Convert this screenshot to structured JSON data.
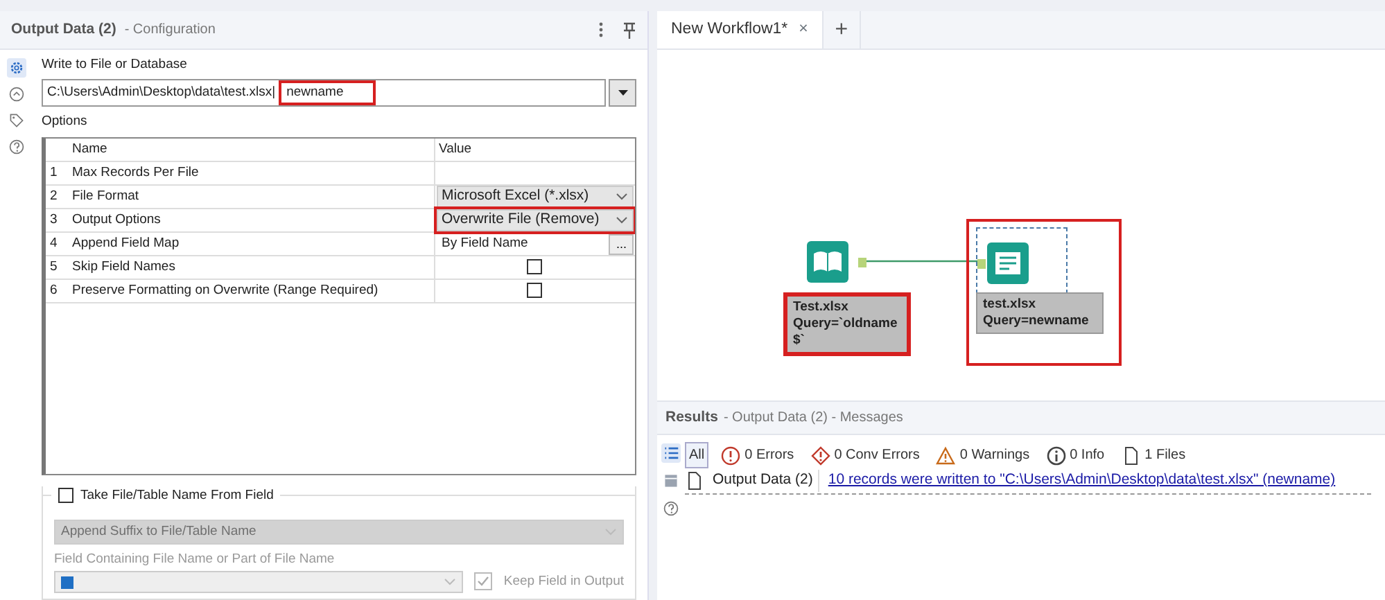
{
  "config_panel": {
    "title": "Output Data (2)",
    "subtitle": "- Configuration",
    "side_tabs": [
      {
        "kind": "gear",
        "selected": true
      },
      {
        "kind": "arrow",
        "selected": false
      },
      {
        "kind": "tag",
        "selected": false
      },
      {
        "kind": "help",
        "selected": false
      }
    ]
  },
  "write_to": {
    "label": "Write to File or Database",
    "path": "C:\\Users\\Admin\\Desktop\\data\\test.xlsx|",
    "suffix": "newname",
    "suffix_highlighted": true
  },
  "options": {
    "label": "Options",
    "columns": [
      "Name",
      "Value"
    ],
    "rows": [
      {
        "number": "1",
        "name": "Max Records Per File",
        "kind": "text",
        "highlighted": false
      },
      {
        "number": "2",
        "name": "File Format",
        "kind": "dropdown",
        "value": "Microsoft Excel (*.xlsx)",
        "highlighted": false
      },
      {
        "number": "3",
        "name": "Output Options",
        "kind": "dropdown",
        "value": "Overwrite File (Remove)",
        "highlighted": true
      },
      {
        "number": "4",
        "name": "Append Field Map",
        "kind": "ellipsis",
        "value": "By Field Name",
        "button_label": "...",
        "highlighted": false
      },
      {
        "number": "5",
        "name": "Skip Field Names",
        "kind": "checkbox",
        "checked": false,
        "highlighted": false
      },
      {
        "number": "6",
        "name": "Preserve Formatting on Overwrite (Range Required)",
        "kind": "checkbox",
        "checked": false,
        "highlighted": false
      }
    ]
  },
  "take_from_field": {
    "label": "Take File/Table Name From Field",
    "checked": false,
    "disabled": true,
    "mode": "Append Suffix to File/Table Name",
    "field_label": "Field Containing File Name or Part of File Name",
    "keep_field": {
      "label": "Keep Field in Output",
      "checked": true
    }
  },
  "workflow_tabs": [
    {
      "label": "New Workflow1*",
      "selected": true,
      "close": "×"
    }
  ],
  "new_tab": "+",
  "canvas": {
    "nodes": [
      {
        "kind": "input",
        "label_lines": [
          "Test.xlsx",
          "Query=`oldname",
          "$`"
        ],
        "highlighted": true,
        "selected": false
      },
      {
        "kind": "output",
        "label_lines": [
          "test.xlsx",
          "Query=newname"
        ],
        "highlighted": true,
        "selected": true
      }
    ]
  },
  "results": {
    "title": "Results",
    "subtitle": "- Output Data (2) - Messages",
    "side_tabs": [
      {
        "kind": "list",
        "selected": true
      },
      {
        "kind": "table",
        "selected": false
      },
      {
        "kind": "help",
        "selected": false
      }
    ],
    "filters": [
      {
        "kind": "all",
        "label": "All",
        "selected": true
      },
      {
        "kind": "error",
        "label": "0 Errors",
        "selected": false
      },
      {
        "kind": "conv",
        "label": "0 Conv Errors",
        "selected": false
      },
      {
        "kind": "warning",
        "label": "0 Warnings",
        "selected": false
      },
      {
        "kind": "info",
        "label": "0 Info",
        "selected": false
      },
      {
        "kind": "file",
        "label": "1 Files",
        "selected": false
      }
    ],
    "messages": [
      {
        "tool": "Output Data (2)",
        "text": "10 records were written to \"C:\\Users\\Admin\\Desktop\\data\\test.xlsx\" (newname)"
      }
    ]
  }
}
